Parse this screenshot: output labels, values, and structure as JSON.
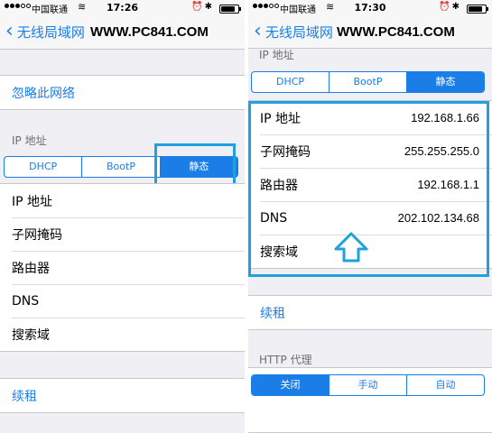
{
  "colors": {
    "accent": "#1a7ee6",
    "annotation": "#1fa0e0",
    "background": "#efeff4"
  },
  "left": {
    "status": {
      "carrier": "中国联通",
      "time": "17:26",
      "battery_level": 0.85
    },
    "nav": {
      "back_label": "无线局域网",
      "title": "WWW.PC841.COM"
    },
    "forget_network": "忽略此网络",
    "ip_section_label": "IP 地址",
    "segments": [
      "DHCP",
      "BootP",
      "静态"
    ],
    "selected_segment": "静态",
    "fields": [
      {
        "label": "IP 地址",
        "value": ""
      },
      {
        "label": "子网掩码",
        "value": ""
      },
      {
        "label": "路由器",
        "value": ""
      },
      {
        "label": "DNS",
        "value": ""
      },
      {
        "label": "搜索域",
        "value": ""
      }
    ],
    "renew_lease": "续租"
  },
  "right": {
    "status": {
      "carrier": "中国联通",
      "time": "17:30",
      "battery_level": 0.85
    },
    "nav": {
      "back_label": "无线局域网",
      "title": "WWW.PC841.COM"
    },
    "ip_section_label": "IP 地址",
    "segments": [
      "DHCP",
      "BootP",
      "静态"
    ],
    "selected_segment": "静态",
    "fields": [
      {
        "label": "IP 地址",
        "value": "192.168.1.66"
      },
      {
        "label": "子网掩码",
        "value": "255.255.255.0"
      },
      {
        "label": "路由器",
        "value": "192.168.1.1"
      },
      {
        "label": "DNS",
        "value": "202.102.134.68"
      },
      {
        "label": "搜索域",
        "value": ""
      }
    ],
    "renew_lease": "续租",
    "http_proxy_label": "HTTP 代理",
    "proxy_segments": [
      "关闭",
      "手动",
      "自动"
    ],
    "proxy_selected": "关闭"
  }
}
